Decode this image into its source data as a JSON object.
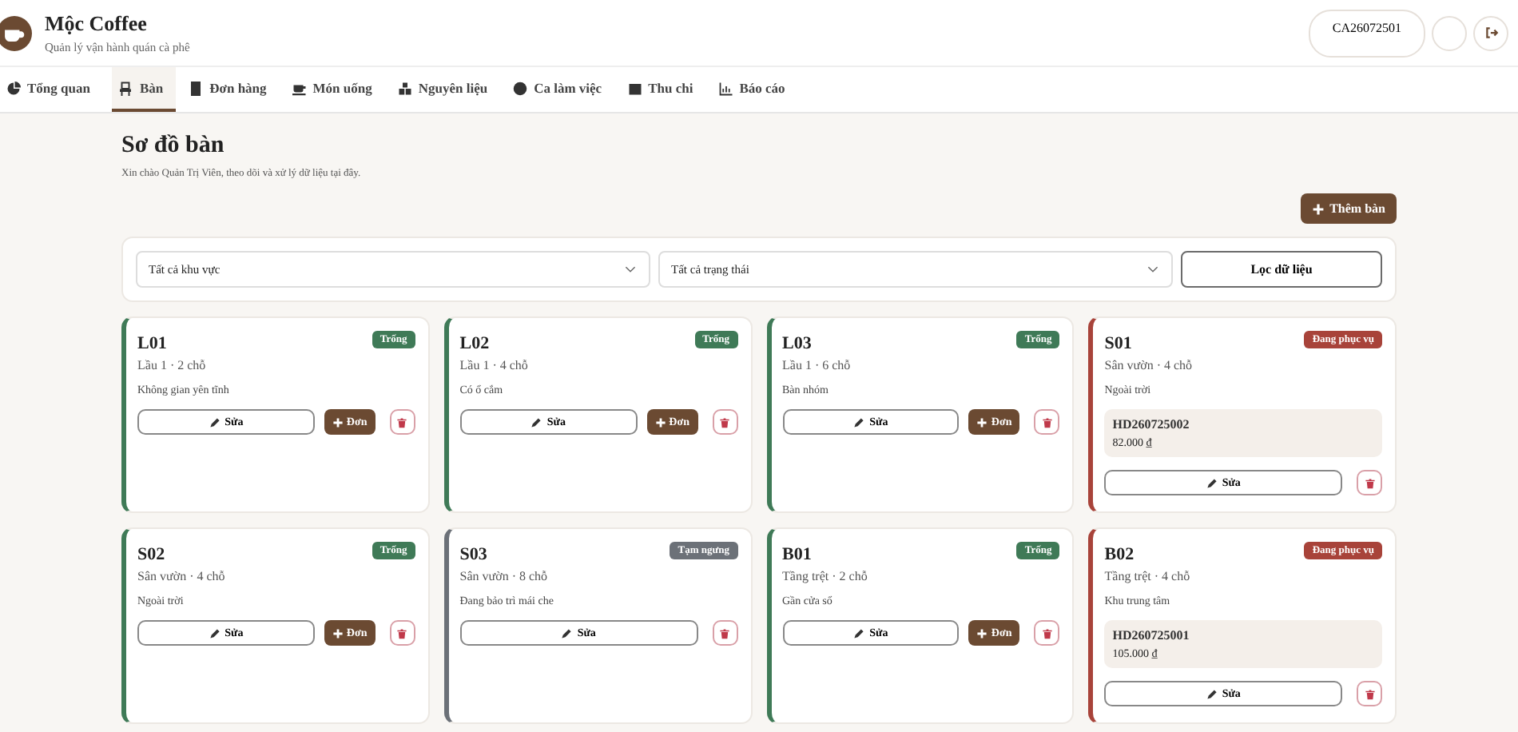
{
  "brand": {
    "name": "Mộc Coffee",
    "tagline": "Quản lý vận hành quán cà phê"
  },
  "user": {
    "code": "CA26072501"
  },
  "tabs": [
    {
      "label": "Tổng quan",
      "kind": "pie",
      "selected": false
    },
    {
      "label": "Bàn",
      "kind": "chair",
      "selected": true
    },
    {
      "label": "Đơn hàng",
      "kind": "receipt",
      "selected": false
    },
    {
      "label": "Món uống",
      "kind": "cup",
      "selected": false
    },
    {
      "label": "Nguyên liệu",
      "kind": "boxes",
      "selected": false
    },
    {
      "label": "Ca làm việc",
      "kind": "clock",
      "selected": false
    },
    {
      "label": "Thu chi",
      "kind": "wallet",
      "selected": false
    },
    {
      "label": "Báo cáo",
      "kind": "chart",
      "selected": false
    }
  ],
  "page": {
    "title": "Sơ đồ bàn",
    "subtitle": "Xin chào Quản Trị Viên, theo dõi và xử lý dữ liệu tại đây.",
    "add_button": "Thêm bàn"
  },
  "filters": {
    "area": "Tất cả khu vực",
    "status": "Tất cả trạng thái",
    "apply_button": "Lọc dữ liệu"
  },
  "tables": [
    {
      "code": "L01",
      "place": "Lầu 1 · 2 chỗ",
      "note": "Không gian yên tĩnh",
      "status": "Trống",
      "kind": "free",
      "edit": "Sửa",
      "order_button": "Đơn"
    },
    {
      "code": "L02",
      "place": "Lầu 1 · 4 chỗ",
      "note": "Có ổ cắm",
      "status": "Trống",
      "kind": "free",
      "edit": "Sửa",
      "order_button": "Đơn"
    },
    {
      "code": "L03",
      "place": "Lầu 1 · 6 chỗ",
      "note": "Bàn nhóm",
      "status": "Trống",
      "kind": "free",
      "edit": "Sửa",
      "order_button": "Đơn"
    },
    {
      "code": "S01",
      "place": "Sân vườn · 4 chỗ",
      "note": "Ngoài trời",
      "status": "Đang phục vụ",
      "kind": "serving",
      "edit": "Sửa",
      "order": {
        "id": "HD260725002",
        "total": "82.000 ₫"
      }
    },
    {
      "code": "S02",
      "place": "Sân vườn · 4 chỗ",
      "note": "Ngoài trời",
      "status": "Trống",
      "kind": "free",
      "edit": "Sửa",
      "order_button": "Đơn"
    },
    {
      "code": "S03",
      "place": "Sân vườn · 8 chỗ",
      "note": "Đang bảo trì mái che",
      "status": "Tạm ngưng",
      "kind": "paused",
      "edit": "Sửa"
    },
    {
      "code": "B01",
      "place": "Tầng trệt · 2 chỗ",
      "note": "Gần cửa sổ",
      "status": "Trống",
      "kind": "free",
      "edit": "Sửa",
      "order_button": "Đơn"
    },
    {
      "code": "B02",
      "place": "Tầng trệt · 4 chỗ",
      "note": "Khu trung tâm",
      "status": "Đang phục vụ",
      "kind": "serving",
      "edit": "Sửa",
      "order": {
        "id": "HD260725001",
        "total": "105.000 ₫"
      }
    }
  ]
}
